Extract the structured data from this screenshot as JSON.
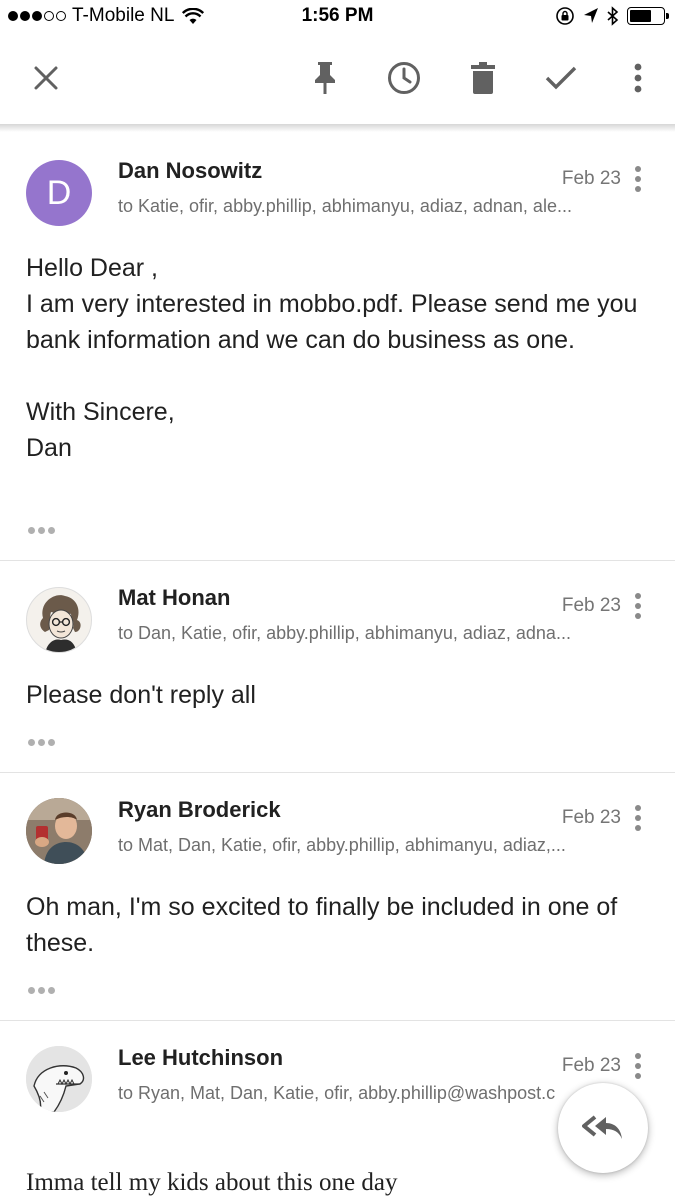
{
  "status_bar": {
    "carrier": "T-Mobile NL",
    "time": "1:56 PM",
    "signal_bars_filled": 3,
    "signal_bars_total": 5,
    "battery_level_percent": 65
  },
  "toolbar": {
    "icons": [
      "close-icon",
      "pin-icon",
      "snooze-clock-icon",
      "trash-icon",
      "done-check-icon",
      "more-vert-icon"
    ]
  },
  "messages": [
    {
      "sender": "Dan Nosowitz",
      "avatar_letter": "D",
      "avatar_color": "#9575cd",
      "recipients": "to Katie, ofir, abby.phillip, abhimanyu, adiaz, adnan, ale...",
      "date": "Feb 23",
      "body": "Hello Dear ,\nI am very interested in mobbo.pdf. Please send me you bank information and we can do business as one.\n\nWith Sincere,\nDan"
    },
    {
      "sender": "Mat Honan",
      "recipients": "to Dan, Katie, ofir, abby.phillip, abhimanyu, adiaz, adna...",
      "date": "Feb 23",
      "body": "Please don't reply all"
    },
    {
      "sender": "Ryan Broderick",
      "recipients": "to Mat, Dan, Katie, ofir, abby.phillip, abhimanyu, adiaz,...",
      "date": "Feb 23",
      "body": "Oh man, I'm so excited to finally be included in one of these."
    },
    {
      "sender": "Lee Hutchinson",
      "recipients": "to Ryan, Mat, Dan, Katie, ofir, abby.phillip@washpost.c",
      "date": "Feb 23",
      "body": "Imma tell my kids about this one day"
    }
  ],
  "fab": {
    "icon": "reply-all-icon"
  },
  "colors": {
    "accent": "#9575cd",
    "icon_gray": "#616161",
    "divider": "#e3e3e3"
  }
}
